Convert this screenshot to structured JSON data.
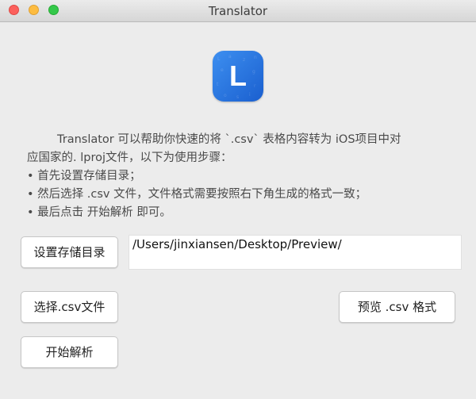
{
  "window": {
    "title": "Translator"
  },
  "app_icon": {
    "letter": "L",
    "color": "#2a74e0"
  },
  "description": {
    "lines": [
      "Translator 可以帮助你快速的将 `.csv` 表格内容转为 iOS项目中对",
      "应国家的. lproj文件，以下为使用步骤：",
      "• 首先设置存储目录；",
      "• 然后选择 .csv 文件，文件格式需要按照右下角生成的格式一致；",
      "• 最后点击 开始解析 即可。"
    ]
  },
  "buttons": {
    "set_directory": "设置存储目录",
    "select_csv": "选择.csv文件",
    "start_parse": "开始解析",
    "preview_format": "预览 .csv 格式"
  },
  "path_field": {
    "value": "/Users/jinxiansen/Desktop/Preview/"
  }
}
